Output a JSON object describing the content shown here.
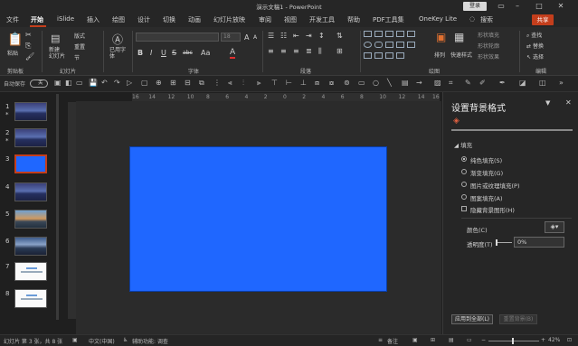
{
  "window": {
    "title": "演示文稿1 - PowerPoint",
    "signin": "登录"
  },
  "tabs": [
    {
      "label": "文件"
    },
    {
      "label": "开始"
    },
    {
      "label": "iSlide"
    },
    {
      "label": "插入"
    },
    {
      "label": "绘图"
    },
    {
      "label": "设计"
    },
    {
      "label": "切换"
    },
    {
      "label": "动画"
    },
    {
      "label": "幻灯片放映"
    },
    {
      "label": "审阅"
    },
    {
      "label": "视图"
    },
    {
      "label": "开发工具"
    },
    {
      "label": "帮助"
    },
    {
      "label": "PDF工具集"
    },
    {
      "label": "OneKey Lite"
    },
    {
      "label": "搜索"
    }
  ],
  "share_label": "共享",
  "ribbon": {
    "groups": {
      "clipboard": "剪贴板",
      "slides": "幻灯片",
      "font": "字体",
      "paragraph": "段落",
      "drawing": "绘图",
      "editing": "编辑"
    },
    "paste": "粘贴",
    "new_slide": "新建\n幻灯片",
    "layout": "版式",
    "reset": "重置",
    "section": "节",
    "reuse": "已用字\n体",
    "font_size": "18",
    "arrange": "排列",
    "quick_styles": "快速样式",
    "shape_fill": "形状填充",
    "shape_outline": "形状轮廓",
    "shape_effects": "形状效果",
    "find": "查找",
    "replace": "替换",
    "select": "选择",
    "bold": "B",
    "italic": "I",
    "underline": "U",
    "strike": "S",
    "abc": "abc",
    "font_color_a": "A",
    "grow": "A",
    "shrink": "A",
    "aa": "Aa"
  },
  "qat": {
    "autosave": "自动保存",
    "toggle": "关"
  },
  "thumbnails": [
    {
      "num": "1",
      "star": "*",
      "style": "city"
    },
    {
      "num": "2",
      "star": "*",
      "style": "city"
    },
    {
      "num": "3",
      "star": "",
      "style": "blue"
    },
    {
      "num": "4",
      "star": "",
      "style": "city"
    },
    {
      "num": "5",
      "star": "",
      "style": "city3"
    },
    {
      "num": "6",
      "star": "",
      "style": "city2"
    },
    {
      "num": "7",
      "star": "",
      "style": "light"
    },
    {
      "num": "8",
      "star": "",
      "style": "light"
    }
  ],
  "ruler": {
    "labels": [
      "16",
      "14",
      "12",
      "10",
      "8",
      "6",
      "4",
      "2",
      "0",
      "2",
      "4",
      "6",
      "8",
      "10",
      "12",
      "14",
      "16"
    ]
  },
  "slide": {
    "fill_color": "#1f67ff"
  },
  "pane": {
    "title": "设置背景格式",
    "section": "填充",
    "options": [
      {
        "label": "纯色填充(S)",
        "on": true
      },
      {
        "label": "渐变填充(G)",
        "on": false
      },
      {
        "label": "图片或纹理填充(P)",
        "on": false
      },
      {
        "label": "图案填充(A)",
        "on": false
      }
    ],
    "hide_bg": "隐藏背景图形(H)",
    "color_label": "颜色(C)",
    "transparency_label": "透明度(T)",
    "transparency_value": "0%",
    "apply_all": "应用到全部(L)",
    "reset_bg": "重置背景(B)"
  },
  "status": {
    "slide_info": "幻灯片 第 3 张，共 8 张",
    "language": "中文(中国)",
    "accessibility": "辅助功能: 调查",
    "notes": "备注",
    "zoom": "42%"
  },
  "colors": {
    "accent": "#c43e1c",
    "slide_blue": "#1f67ff"
  }
}
